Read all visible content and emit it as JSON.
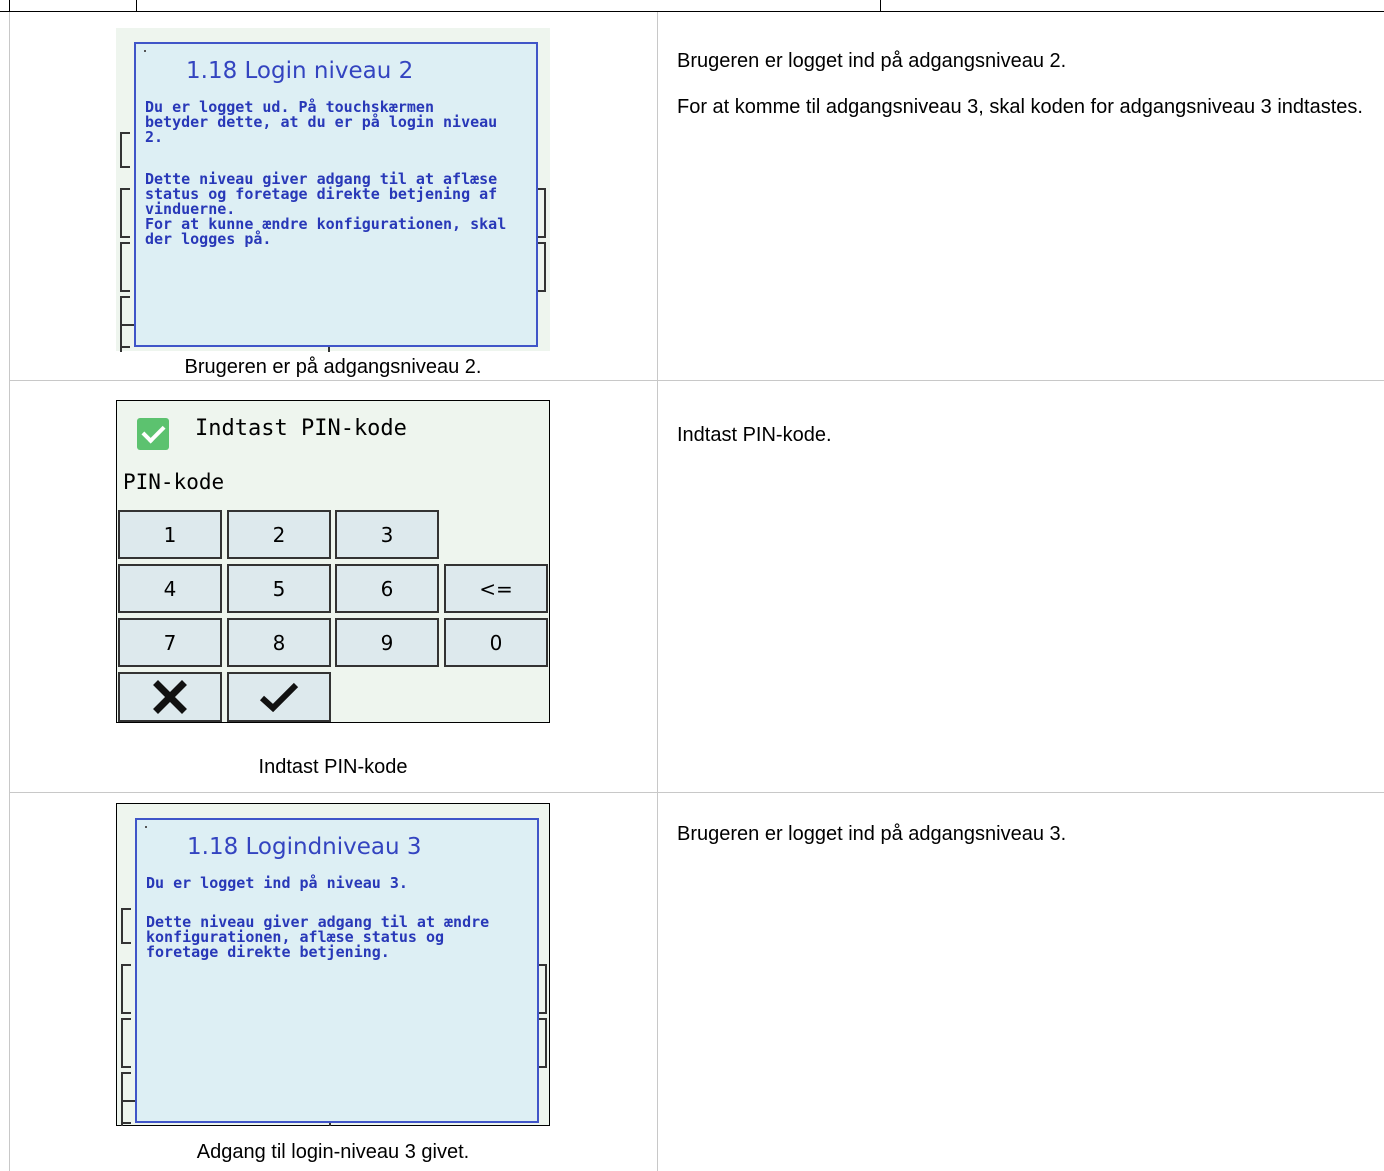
{
  "rows": [
    {
      "screen": {
        "popup_title": "1.18 Login niveau 2",
        "popup_text_1": "Du er logget ud. På touchskærmen\nbetyder dette, at du er på login niveau\n2.",
        "popup_text_2": "Dette niveau giver adgang til at aflæse\nstatus og foretage direkte betjening af\nvinduerne.\nFor at kunne ændre konfigurationen, skal\nder logges på."
      },
      "caption": "Brugeren er på adgangsniveau 2.",
      "description": [
        "Brugeren er logget ind på adgangsniveau 2.",
        "For at komme til adgangsniveau 3, skal koden for adgangsniveau 3 indtastes."
      ]
    },
    {
      "screen": {
        "title": "Indtast PIN-kode",
        "field_label": "PIN-kode",
        "keys": [
          "1",
          "2",
          "3",
          "4",
          "5",
          "6",
          "<=",
          "7",
          "8",
          "9",
          "0"
        ],
        "cancel_icon": "x-icon",
        "confirm_icon": "checkmark-icon",
        "checkbox_color": "#5cc26f"
      },
      "caption": "Indtast PIN-kode",
      "description": [
        "Indtast PIN-kode."
      ]
    },
    {
      "screen": {
        "popup_title": "1.18 Logindniveau 3",
        "popup_text_1": "Du er logget ind på niveau 3.",
        "popup_text_2": "Dette niveau giver adgang til at ændre\nkonfigurationen, aflæse status og\nforetage direkte betjening."
      },
      "caption": "Adgang til login-niveau 3 givet.",
      "description": [
        "Brugeren er logget ind på adgangsniveau 3."
      ]
    }
  ],
  "colors": {
    "popup_border": "#4055c8",
    "popup_text": "#2838b8",
    "popup_bg": "#ddeff4",
    "key_bg": "#dde9ed"
  }
}
